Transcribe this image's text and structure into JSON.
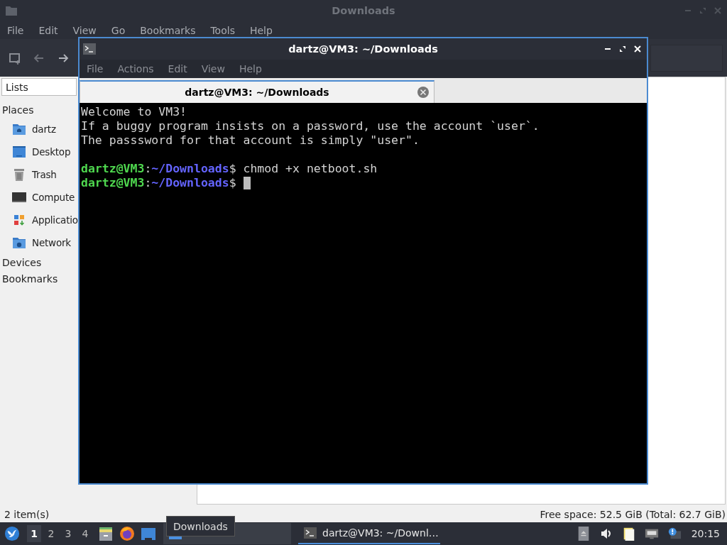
{
  "file_manager": {
    "title": "Downloads",
    "active": false,
    "menu": [
      "File",
      "Edit",
      "View",
      "Go",
      "Bookmarks",
      "Tools",
      "Help"
    ],
    "sidebar": {
      "view_selector": "Lists",
      "sections": [
        {
          "title": "Places",
          "items": [
            {
              "label": "dartz",
              "kind": "home"
            },
            {
              "label": "Desktop",
              "kind": "desktop"
            },
            {
              "label": "Trash",
              "kind": "trash"
            },
            {
              "label": "Compute",
              "kind": "computer"
            },
            {
              "label": "Applicatio",
              "kind": "apps"
            },
            {
              "label": "Network",
              "kind": "network"
            }
          ]
        },
        {
          "title": "Devices"
        },
        {
          "title": "Bookmarks"
        }
      ]
    },
    "status_bar": {
      "items": "2 item(s)",
      "free_space": "Free space: 52.5 GiB (Total: 62.7 GiB)"
    }
  },
  "terminal": {
    "title": "dartz@VM3: ~/Downloads",
    "active": true,
    "menu": [
      "File",
      "Actions",
      "Edit",
      "View",
      "Help"
    ],
    "tabs": [
      {
        "label": "dartz@VM3: ~/Downloads",
        "selected": true
      }
    ],
    "lines": [
      {
        "kind": "text",
        "text": "Welcome to VM3!"
      },
      {
        "kind": "text",
        "text": "If a buggy program insists on a password, use the account `user`."
      },
      {
        "kind": "text",
        "text": "The passsword for that account is simply \"user\"."
      },
      {
        "kind": "blank"
      },
      {
        "kind": "prompt",
        "user": "dartz@VM3",
        "separator": ":",
        "path": "~/Downloads",
        "symbol": "$",
        "command": "chmod +x netboot.sh"
      },
      {
        "kind": "prompt",
        "user": "dartz@VM3",
        "separator": ":",
        "path": "~/Downloads",
        "symbol": "$",
        "cursor": true
      }
    ]
  },
  "taskbar": {
    "workspaces": [
      {
        "label": "1",
        "selected": true
      },
      {
        "label": "2",
        "selected": false
      },
      {
        "label": "3",
        "selected": false
      },
      {
        "label": "4",
        "selected": false
      }
    ],
    "tasks": [
      {
        "kind": "folder",
        "selected": false
      },
      {
        "kind": "terminal",
        "label": "dartz@VM3: ~/Downl…",
        "selected": true
      }
    ],
    "tooltip": "Downloads",
    "clock": "20:15"
  }
}
